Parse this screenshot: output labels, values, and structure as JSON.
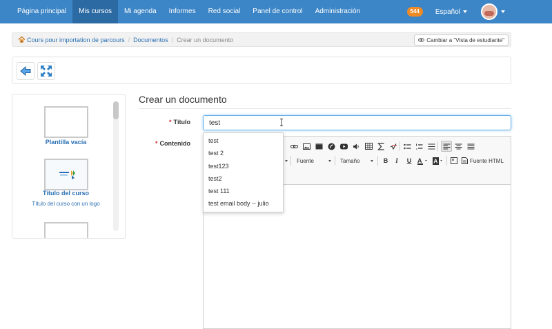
{
  "navbar": {
    "items": [
      {
        "label": "Página principal"
      },
      {
        "label": "Mis cursos"
      },
      {
        "label": "Mi agenda"
      },
      {
        "label": "Informes"
      },
      {
        "label": "Red social"
      },
      {
        "label": "Panel de control"
      },
      {
        "label": "Administración"
      }
    ],
    "active_item": "Mis cursos",
    "notifications_count": "544",
    "language": "Español",
    "brand_color": "#3c85c6",
    "active_color": "#2c6aa3",
    "badge_color": "#f08a24"
  },
  "breadcrumb": {
    "items": [
      {
        "label": "Cours pour importation de parcours"
      },
      {
        "label": "Documentos"
      },
      {
        "label": "Crear un documento"
      }
    ],
    "student_view_label": "Cambiar a \"Vista de estudiante\""
  },
  "toolbar": {
    "icons": [
      "back-icon",
      "fullscreen-icon"
    ]
  },
  "templates": {
    "items": [
      {
        "title": "Plantilla vacía",
        "subtitle": ""
      },
      {
        "title": "Título del curso",
        "subtitle": "Título del curso con un logo"
      }
    ]
  },
  "form": {
    "heading": "Crear un documento",
    "title_label": "Título",
    "content_label": "Contenido",
    "title_value": "test"
  },
  "editor": {
    "font_label": "Fuente",
    "size_label": "Tamaño",
    "source_label": "Fuente HTML"
  },
  "autocomplete": {
    "options": [
      "test",
      "test 2",
      "test123",
      "test2",
      "test 111",
      "test email body -- julio"
    ]
  }
}
